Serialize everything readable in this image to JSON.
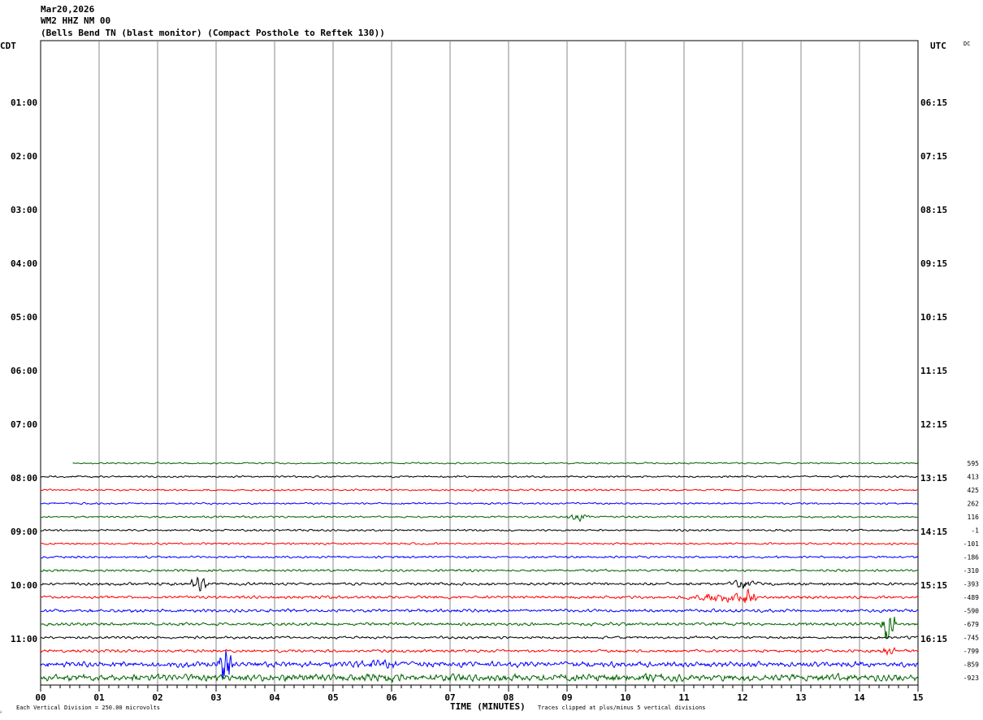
{
  "header": {
    "date": "Mar20,2026",
    "station": "WM2 HHZ NM 00",
    "description": "(Bells Bend TN (blast monitor) (Compact Posthole to Reftek 130))"
  },
  "left_tz": "CDT",
  "right_tz": "UTC",
  "dc_label": "DC",
  "footer": {
    "scale_note": "Each Vertical Division =  250.00 microvolts",
    "xlabel": "TIME (MINUTES)",
    "clip_note": "Traces clipped at plus/minus 5 vertical divisions",
    "corner_mark": "⁁"
  },
  "chart_data": {
    "type": "line",
    "title": "WM2 HHZ NM 00",
    "xlabel": "TIME (MINUTES)",
    "xlim": [
      0,
      15
    ],
    "x_ticks": [
      "00",
      "01",
      "02",
      "03",
      "04",
      "05",
      "06",
      "07",
      "08",
      "09",
      "10",
      "11",
      "12",
      "13",
      "14",
      "15"
    ],
    "left_hour_labels": [
      "01:00",
      "02:00",
      "03:00",
      "04:00",
      "05:00",
      "06:00",
      "07:00",
      "08:00",
      "09:00",
      "10:00",
      "11:00"
    ],
    "right_hour_labels": [
      "06:15",
      "07:15",
      "08:15",
      "09:15",
      "10:15",
      "11:15",
      "12:15",
      "13:15",
      "14:15",
      "15:15",
      "16:15"
    ],
    "colors": {
      "green": "#006400",
      "black": "#000000",
      "red": "#ff0000",
      "blue": "#0000ff",
      "grid": "#888888"
    },
    "traces": [
      {
        "color": "green",
        "start_min": 0.55,
        "dc": "595",
        "amp": 1,
        "events": []
      },
      {
        "color": "black",
        "start_min": 0,
        "dc": "413",
        "amp": 1.2,
        "events": []
      },
      {
        "color": "red",
        "start_min": 0,
        "dc": "425",
        "amp": 1.2,
        "events": []
      },
      {
        "color": "blue",
        "start_min": 0,
        "dc": "262",
        "amp": 1.2,
        "events": []
      },
      {
        "color": "green",
        "start_min": 0,
        "dc": "116",
        "amp": 1.2,
        "events": [
          [
            9.2,
            0.25,
            5
          ]
        ]
      },
      {
        "color": "black",
        "start_min": 0,
        "dc": "-1",
        "amp": 1.3,
        "events": []
      },
      {
        "color": "red",
        "start_min": 0,
        "dc": "-101",
        "amp": 1.3,
        "events": []
      },
      {
        "color": "blue",
        "start_min": 0,
        "dc": "-186",
        "amp": 1.4,
        "events": []
      },
      {
        "color": "green",
        "start_min": 0,
        "dc": "-310",
        "amp": 1.5,
        "events": []
      },
      {
        "color": "black",
        "start_min": 0,
        "dc": "-393",
        "amp": 1.8,
        "events": [
          [
            2.7,
            0.2,
            9
          ],
          [
            12.0,
            0.3,
            6
          ]
        ]
      },
      {
        "color": "red",
        "start_min": 0,
        "dc": "-489",
        "amp": 1.8,
        "events": [
          [
            11.6,
            0.7,
            5
          ],
          [
            12.1,
            0.2,
            9
          ]
        ]
      },
      {
        "color": "blue",
        "start_min": 0,
        "dc": "-590",
        "amp": 2,
        "events": []
      },
      {
        "color": "green",
        "start_min": 0,
        "dc": "-679",
        "amp": 2,
        "events": [
          [
            14.5,
            0.15,
            30
          ]
        ]
      },
      {
        "color": "black",
        "start_min": 0,
        "dc": "-745",
        "amp": 1.6,
        "events": []
      },
      {
        "color": "red",
        "start_min": 0,
        "dc": "-799",
        "amp": 1.8,
        "events": [
          [
            14.5,
            0.15,
            6
          ]
        ]
      },
      {
        "color": "blue",
        "start_min": 0,
        "dc": "-859",
        "amp": 3.5,
        "events": [
          [
            3.15,
            0.15,
            30
          ],
          [
            5.8,
            0.5,
            3
          ]
        ]
      },
      {
        "color": "green",
        "start_min": 0,
        "dc": "-923",
        "amp": 4.5,
        "events": [
          [
            5.8,
            0.4,
            4
          ],
          [
            10.4,
            0.3,
            3
          ]
        ]
      }
    ]
  }
}
